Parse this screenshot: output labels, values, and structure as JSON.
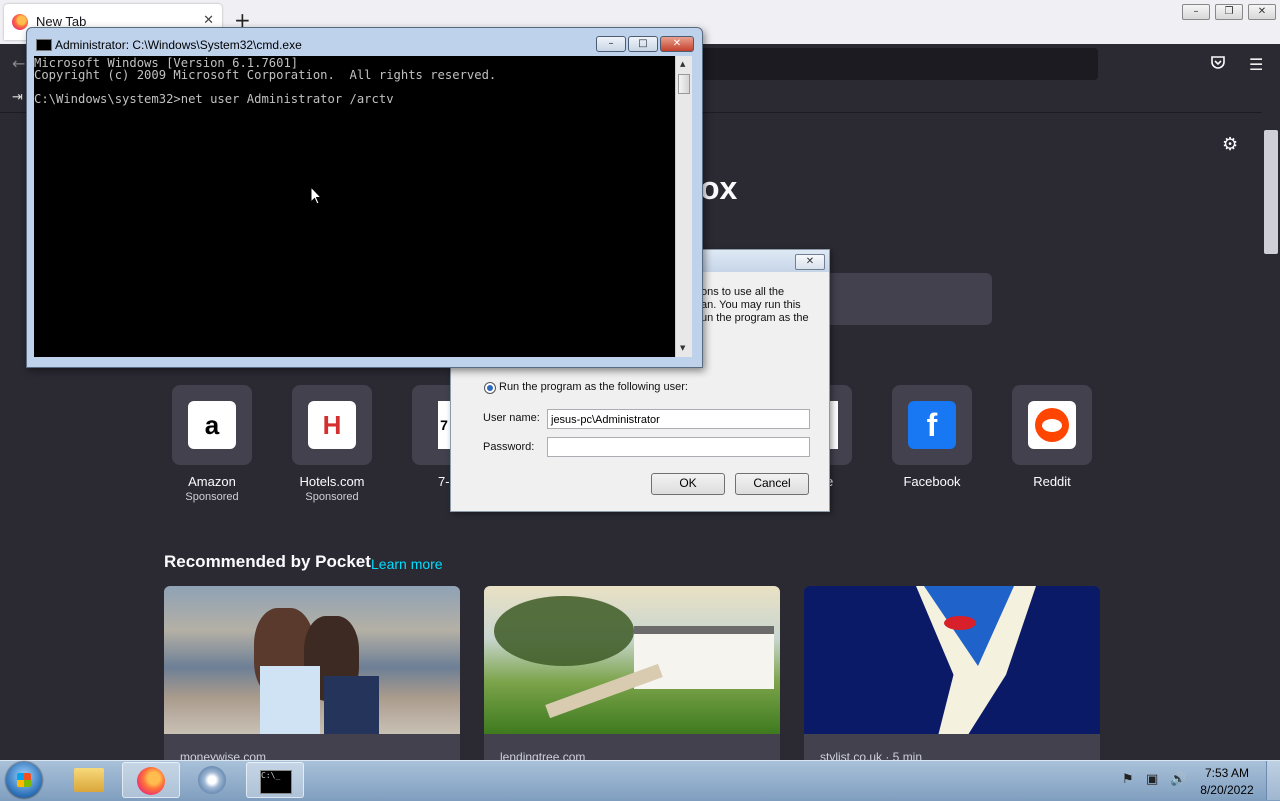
{
  "firefox": {
    "tab_title": "New Tab",
    "tab_close": "✕",
    "new_tab": "+",
    "window_controls": {
      "minimize": "–",
      "restore": "❐",
      "close": "✕"
    },
    "back": "←",
    "menu": "☰",
    "import": "⇥"
  },
  "newtab": {
    "brand_tail": "ox",
    "shortcuts": [
      {
        "label": "Amazon",
        "sub": "Sponsored",
        "icon": "amazon-icon"
      },
      {
        "label": "Hotels.com",
        "sub": "Sponsored",
        "icon": "hotels-icon"
      },
      {
        "label": "7-",
        "sub": "",
        "icon": "seven-zip-icon"
      },
      {
        "label": "e",
        "sub": "",
        "icon": "partial-icon"
      },
      {
        "label": "Facebook",
        "sub": "",
        "icon": "facebook-icon"
      },
      {
        "label": "Reddit",
        "sub": "",
        "icon": "reddit-icon"
      }
    ],
    "pocket_heading": "Recommended by Pocket",
    "pocket_learn": "Learn more",
    "cards": [
      {
        "source": "moneywise.com"
      },
      {
        "source": "lendingtree.com"
      },
      {
        "source": "stylist.co.uk · 5 min"
      }
    ]
  },
  "runas": {
    "close": "✕",
    "text_line1": "ons to use all the",
    "text_line2": "an. You may run this",
    "text_line3": "un the program as the",
    "radio_label": "Run the program as the following user:",
    "username_label": "User name:",
    "username_value": "jesus-pc\\Administrator",
    "password_label": "Password:",
    "password_value": "",
    "ok": "OK",
    "cancel": "Cancel"
  },
  "cmd": {
    "title": "Administrator: C:\\Windows\\System32\\cmd.exe",
    "lines": "Microsoft Windows [Version 6.1.7601]\nCopyright (c) 2009 Microsoft Corporation.  All rights reserved.\n\nC:\\Windows\\system32>net user Administrator /arctv",
    "controls": {
      "minimize": "–",
      "maximize": "□",
      "close": "✕"
    }
  },
  "taskbar": {
    "time": "7:53 AM",
    "date": "8/20/2022",
    "tray_flag": "⚑",
    "tray_network": "▣",
    "tray_volume": "🔊",
    "cmd_icon_text": "C:\\_"
  }
}
